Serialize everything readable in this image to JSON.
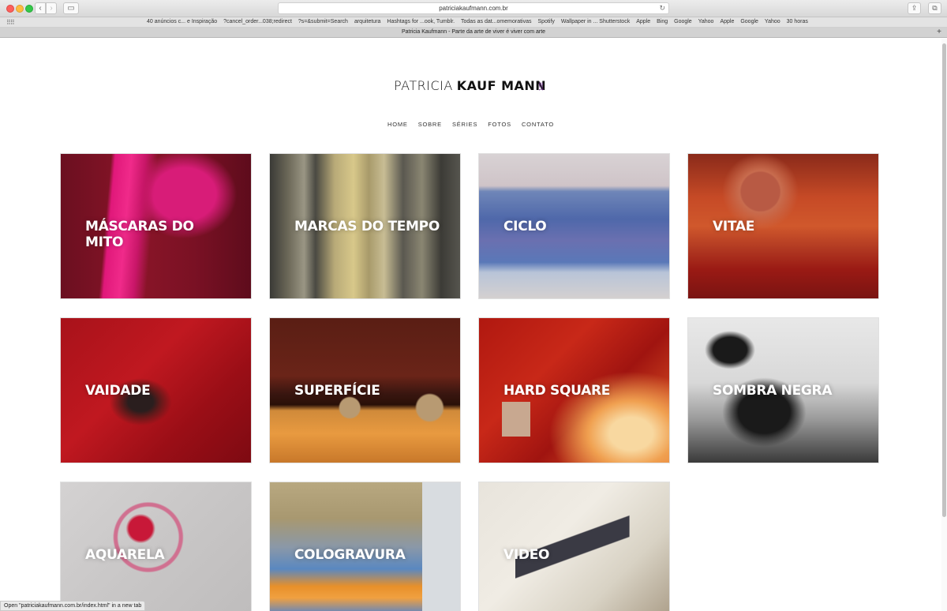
{
  "browser": {
    "url": "patriciakaufmann.com.br",
    "tab_title": "Patricia Kaufmann - Parte da arte de viver é viver com arte",
    "bookmarks": [
      "40 anúncios c... e Inspiração",
      "?cancel_order...038;redirect",
      "?s=&submit=Search",
      "arquitetura",
      "Hashtags for ...ook, Tumblr.",
      "Todas as dat...omemorativas",
      "Spotify",
      "Wallpaper in ... Shutterstock",
      "Apple",
      "Bing",
      "Google",
      "Yahoo",
      "Apple",
      "Google",
      "Yahoo",
      "30 horas"
    ],
    "status_text": "Open \"patriciakaufmann.com.br/index.html\" in a new tab"
  },
  "site": {
    "logo_light": "PATRICIA",
    "logo_bold": "KAUF MANN",
    "logo_tag": "art",
    "nav": [
      "HOME",
      "SOBRE",
      "SÉRIES",
      "FOTOS",
      "CONTATO"
    ]
  },
  "series": [
    {
      "title": "MÁSCARAS DO MITO"
    },
    {
      "title": "MARCAS DO TEMPO"
    },
    {
      "title": "CICLO"
    },
    {
      "title": "VITAE"
    },
    {
      "title": "VAIDADE"
    },
    {
      "title": "SUPERFÍCIE"
    },
    {
      "title": "HARD SQUARE"
    },
    {
      "title": "SOMBRA NEGRA"
    },
    {
      "title": "AQUARELA"
    },
    {
      "title": "COLOGRAVURA"
    },
    {
      "title": "VIDEO"
    }
  ]
}
